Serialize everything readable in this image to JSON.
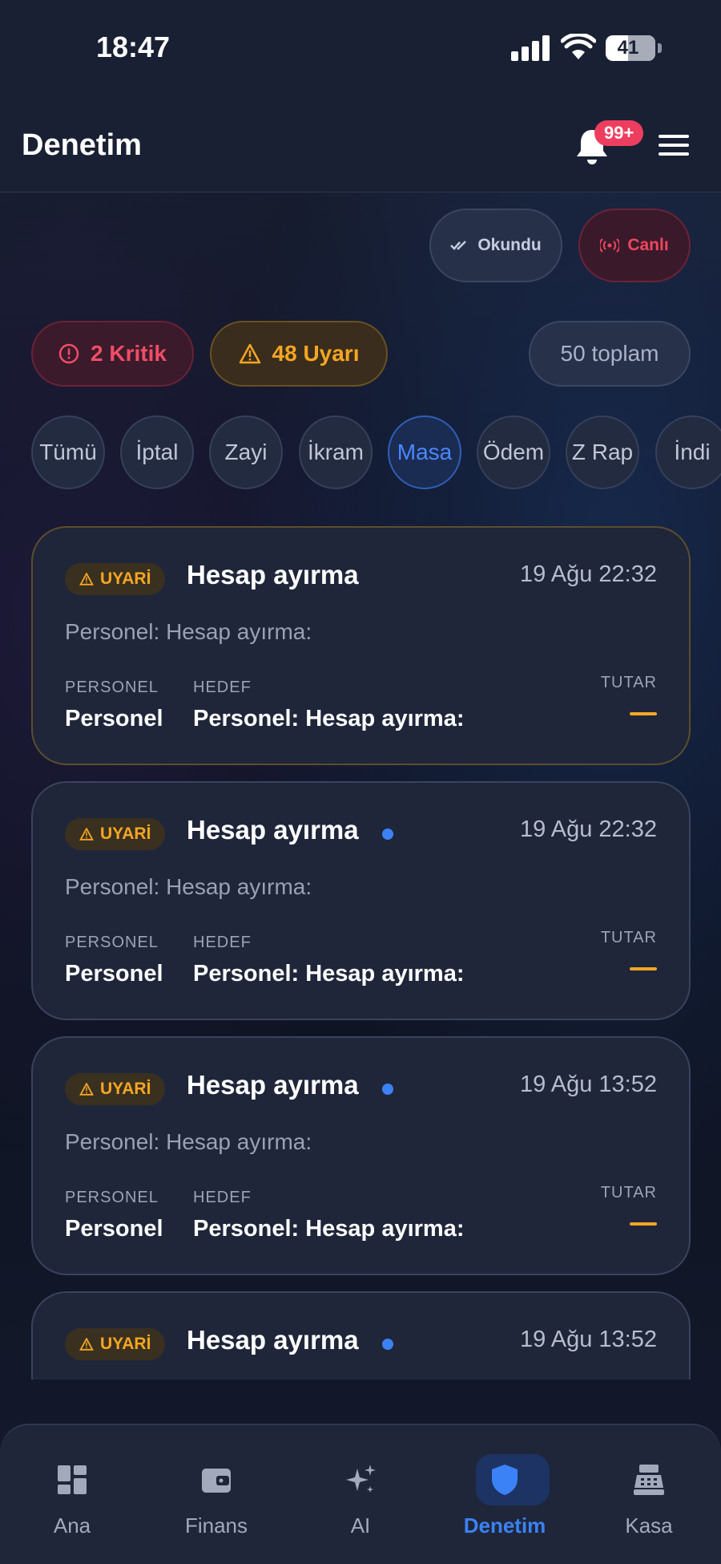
{
  "status": {
    "time": "18:47",
    "battery": "41"
  },
  "header": {
    "title": "Denetim",
    "badge": "99+"
  },
  "actions": {
    "read": "Okundu",
    "live": "Canlı"
  },
  "summary": {
    "critical": "2 Kritik",
    "warnings": "48 Uyarı",
    "total": "50 toplam"
  },
  "tabs": [
    "Tümü",
    "İptal",
    "Zayi",
    "İkram",
    "Masa",
    "Ödem",
    "Z Rap",
    "İndi"
  ],
  "active_tab": "Masa",
  "cards": [
    {
      "tag": "UYARİ",
      "title": "Hesap ayırma",
      "date": "19 Ağu 22:32",
      "desc": "Personel: Hesap ayırma:",
      "personel_label": "PERSONEL",
      "personel": "Personel",
      "hedef_label": "HEDEF",
      "hedef": "Personel: Hesap ayırma:",
      "tutar_label": "TUTAR",
      "unread": false
    },
    {
      "tag": "UYARİ",
      "title": "Hesap ayırma",
      "date": "19 Ağu 22:32",
      "desc": "Personel: Hesap ayırma:",
      "personel_label": "PERSONEL",
      "personel": "Personel",
      "hedef_label": "HEDEF",
      "hedef": "Personel: Hesap ayırma:",
      "tutar_label": "TUTAR",
      "unread": true
    },
    {
      "tag": "UYARİ",
      "title": "Hesap ayırma",
      "date": "19 Ağu 13:52",
      "desc": "Personel: Hesap ayırma:",
      "personel_label": "PERSONEL",
      "personel": "Personel",
      "hedef_label": "HEDEF",
      "hedef": "Personel: Hesap ayırma:",
      "tutar_label": "TUTAR",
      "unread": true
    },
    {
      "tag": "UYARİ",
      "title": "Hesap ayırma",
      "date": "19 Ağu 13:52",
      "desc": "",
      "unread": true
    }
  ],
  "nav": [
    {
      "label": "Ana",
      "icon": "dashboard-icon"
    },
    {
      "label": "Finans",
      "icon": "wallet-icon"
    },
    {
      "label": "AI",
      "icon": "sparkles-icon"
    },
    {
      "label": "Denetim",
      "icon": "shield-icon"
    },
    {
      "label": "Kasa",
      "icon": "cash-register-icon"
    }
  ],
  "colors": {
    "accent": "#3b82f6",
    "warning": "#f5a623",
    "critical": "#f24d66"
  }
}
